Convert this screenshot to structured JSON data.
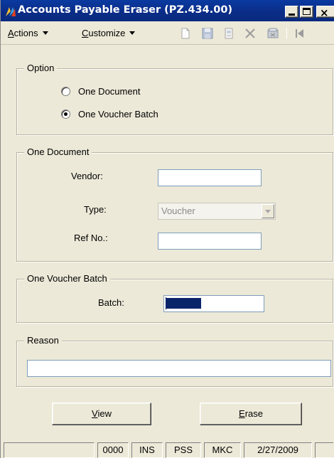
{
  "window": {
    "title": "Accounts Payable Eraser (PZ.434.00)",
    "controls": {
      "minimize": "_",
      "maximize": "□",
      "close": "×"
    }
  },
  "menu": {
    "actions": {
      "label_access": "A",
      "label_rest": "ctions"
    },
    "customize": {
      "label_access": "C",
      "label_rest": "ustomize"
    }
  },
  "toolbar": {
    "icons": [
      "new-document-icon",
      "save-icon",
      "finish-icon",
      "delete-icon",
      "cancel-icon",
      "first-record-icon"
    ]
  },
  "option_group": {
    "legend": "Option",
    "choices": [
      {
        "label": "One Document",
        "checked": false
      },
      {
        "label": "One Voucher Batch",
        "checked": true
      }
    ]
  },
  "document_group": {
    "legend": "One Document",
    "vendor_label": "Vendor:",
    "vendor_value": "",
    "type_label": "Type:",
    "type_value": "Voucher",
    "ref_label": "Ref No.:",
    "ref_value": ""
  },
  "batch_group": {
    "legend": "One Voucher Batch",
    "batch_label": "Batch:",
    "batch_value": ""
  },
  "reason_group": {
    "legend": "Reason",
    "reason_value": ""
  },
  "buttons": {
    "view": {
      "label_access": "V",
      "label_rest": "iew"
    },
    "erase": {
      "label_access": "E",
      "label_rest": "rase"
    }
  },
  "statusbar": {
    "cells": [
      "",
      "0000",
      "INS",
      "PSS",
      "MKC",
      "2/27/2009"
    ]
  },
  "colors": {
    "titlebar": "#0b2c86",
    "window_face": "#ece9d8",
    "selection": "#0a246a"
  }
}
